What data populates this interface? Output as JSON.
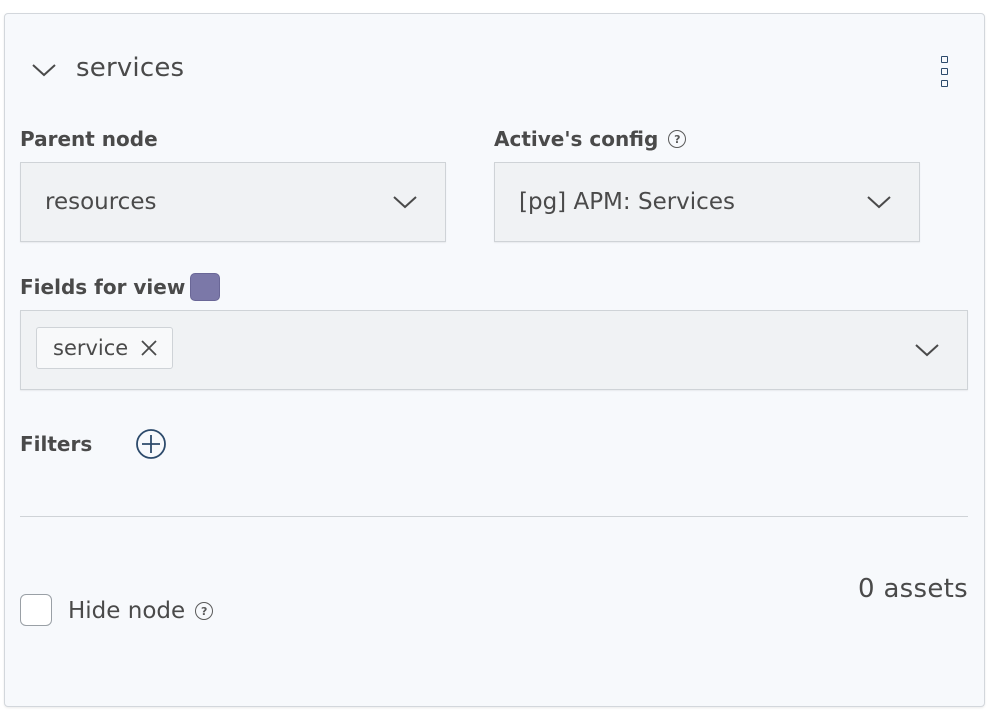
{
  "node": {
    "title": "services",
    "expanded": true
  },
  "parent_node": {
    "label": "Parent node",
    "value": "resources"
  },
  "active_config": {
    "label": "Active's config",
    "value": "[pg] APM: Services",
    "help_icon": "question-circle-icon"
  },
  "fields_for_view": {
    "label": "Fields for view",
    "color": "#7b78a8",
    "tags": [
      {
        "label": "service"
      }
    ]
  },
  "filters": {
    "label": "Filters",
    "add_icon": "plus-circle-icon"
  },
  "hide_node": {
    "label": "Hide node",
    "checked": false,
    "help_icon": "question-circle-icon"
  },
  "assets": {
    "text": "0 assets"
  },
  "colors": {
    "accent_icon": "#2c4a6b",
    "field_bg": "#f0f2f4",
    "card_bg": "#f7f9fc"
  }
}
